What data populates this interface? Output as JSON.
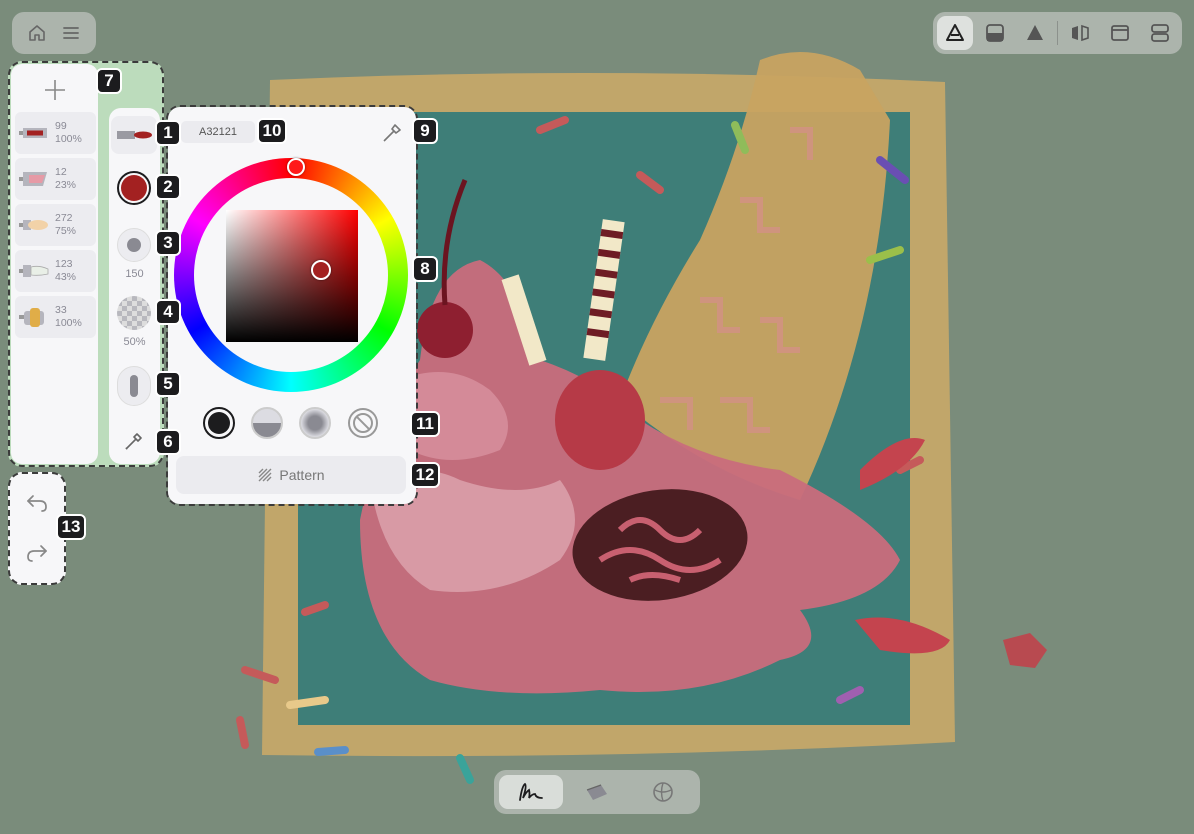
{
  "colors": {
    "current": "#A32121",
    "ui_panel": "#f7f7f9",
    "background": "#7a8c7b",
    "layer_panel_highlight": "#bcdcbc"
  },
  "top_left": {
    "home_icon": "home-icon",
    "menu_icon": "menu-icon"
  },
  "top_right": {
    "tools": [
      "canvas-tool-icon",
      "frame-icon",
      "fill-icon",
      "mirror-icon",
      "window-icon",
      "split-icon"
    ]
  },
  "layers": {
    "add_icon": "plus-icon",
    "items": [
      {
        "size": "99",
        "opacity": "100%",
        "swatch": "#A32121"
      },
      {
        "size": "12",
        "opacity": "23%",
        "swatch": "#e69aa6"
      },
      {
        "size": "272",
        "opacity": "75%",
        "swatch": "#f2d2a8"
      },
      {
        "size": "123",
        "opacity": "43%",
        "swatch": "#e9efe7"
      },
      {
        "size": "33",
        "opacity": "100%",
        "swatch": "#e0ad48"
      }
    ]
  },
  "brush": {
    "size": "150",
    "opacity": "50%"
  },
  "color_panel": {
    "hex": "A32121",
    "pattern_label": "Pattern"
  },
  "bottom_bar": {
    "tools": [
      "brush-stroke-icon",
      "eraser-icon",
      "smudge-icon"
    ]
  },
  "badges": [
    "1",
    "2",
    "3",
    "4",
    "5",
    "6",
    "7",
    "8",
    "9",
    "10",
    "11",
    "12",
    "13"
  ]
}
